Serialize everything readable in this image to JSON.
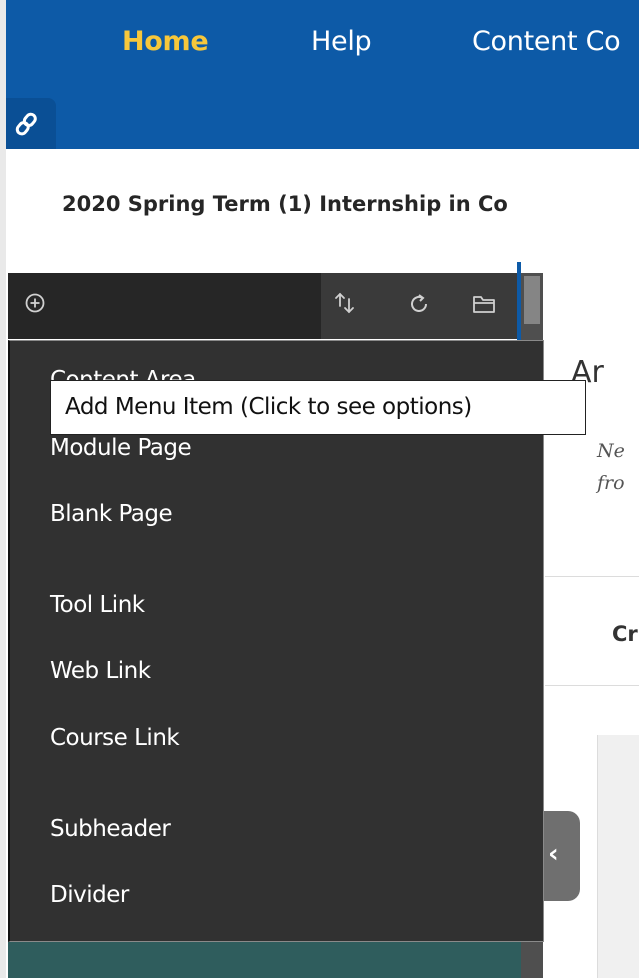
{
  "nav": {
    "home": "Home",
    "help": "Help",
    "content": "Content Co"
  },
  "course": {
    "title": "2020 Spring Term (1) Internship in Co"
  },
  "menu_panel": {
    "add_icon": "plus-circle-icon",
    "tool_icons": [
      "reorder-icon",
      "refresh-icon",
      "folder-icon"
    ]
  },
  "tooltip": {
    "text": "Add Menu Item (Click to see options)"
  },
  "dropdown": {
    "partial_first_item": "Content Area",
    "items": [
      "Module Page",
      "Blank Page",
      "Tool Link",
      "Web Link",
      "Course Link",
      "Subheader",
      "Divider"
    ]
  },
  "content": {
    "heading": "Ar",
    "sub_line1": "Ne",
    "sub_line2": "fro",
    "section": "Cr"
  },
  "collapse": {
    "glyph": "‹"
  },
  "colors": {
    "nav_bg": "#0d5aa7",
    "nav_active": "#f7c73b",
    "menu_bg": "#313131"
  }
}
